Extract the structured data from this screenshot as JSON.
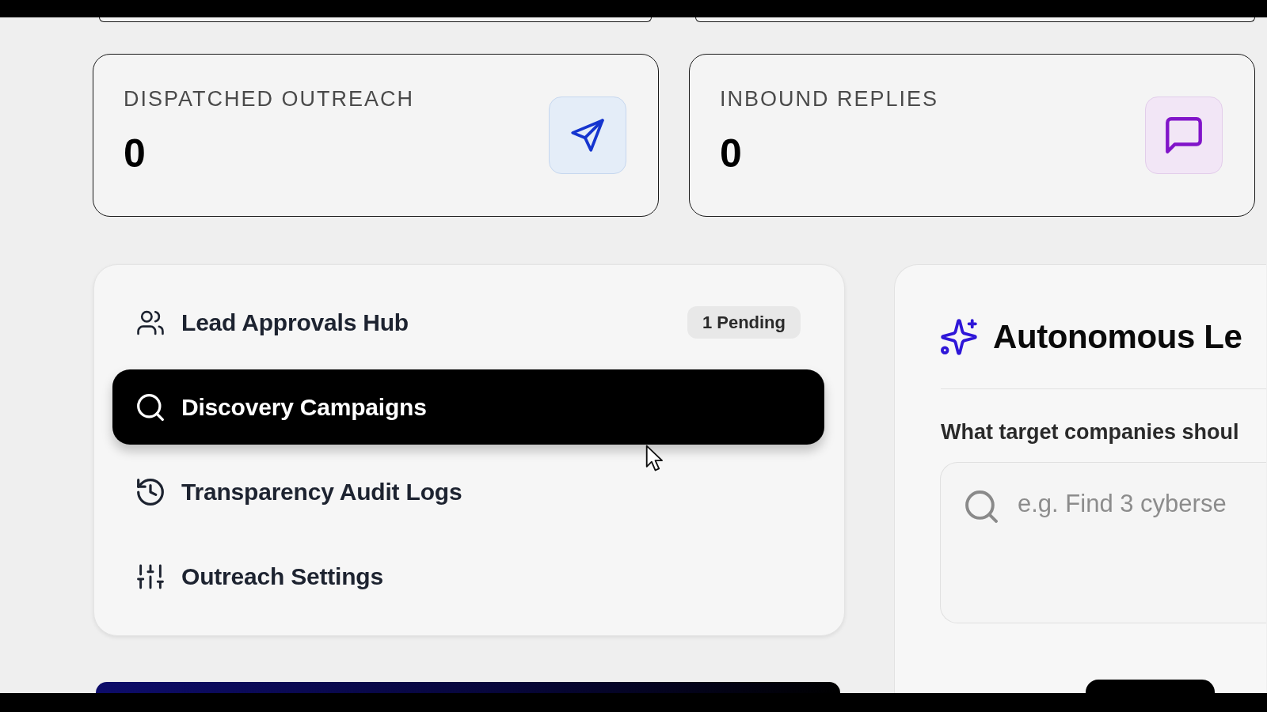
{
  "stats": [
    {
      "kind": "send",
      "label": "DISPATCHED OUTREACH",
      "value": "0"
    },
    {
      "kind": "message",
      "label": "INBOUND REPLIES",
      "value": "0"
    }
  ],
  "nav": {
    "items": [
      {
        "kind": "approvals",
        "label": "Lead Approvals Hub",
        "badge": "1 Pending",
        "selected": false
      },
      {
        "kind": "discovery",
        "label": "Discovery Campaigns",
        "selected": true
      },
      {
        "kind": "audit",
        "label": "Transparency Audit Logs",
        "selected": false
      },
      {
        "kind": "settings",
        "label": "Outreach Settings",
        "selected": false
      }
    ]
  },
  "discovery_panel": {
    "title": "Autonomous Le",
    "prompt_label": "What target companies shoul",
    "prompt": {
      "placeholder": "e.g. Find 3 cyberse"
    }
  }
}
